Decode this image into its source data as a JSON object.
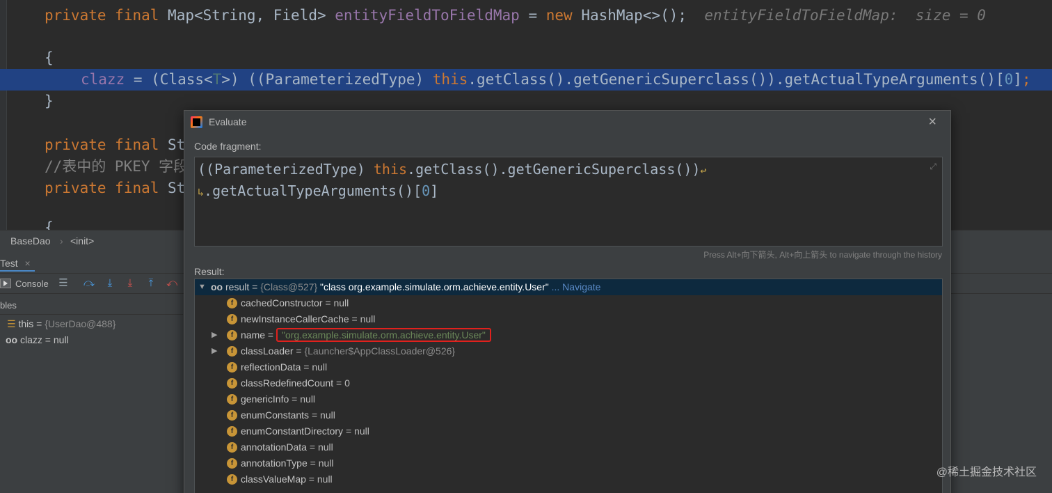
{
  "editor": {
    "line1": {
      "kw1": "private",
      "kw2": "final",
      "type": "Map<String, Field>",
      "field": "entityFieldToFieldMap",
      "eq": " = ",
      "kw3": "new",
      "ctor": "HashMap<>();",
      "hint": "entityFieldToFieldMap:  size = 0"
    },
    "line2": "{",
    "line3": {
      "field": "clazz",
      "eq": " = ",
      "cast_open": "(Class<",
      "tp": "T",
      "cast_close": ">)",
      "mid": " ((ParameterizedType) ",
      "kw": "this",
      "rest": ".getClass().getGenericSuperclass()).getActualTypeArguments()[",
      "num": "0",
      "end": "]",
      "semi": ";"
    },
    "line4": "}",
    "line5": {
      "kw1": "private",
      "kw2": "final",
      "rest": "St"
    },
    "line6": "//表中的 PKEY 字段",
    "line7": {
      "kw1": "private",
      "kw2": "final",
      "rest": "St"
    },
    "line8": "{"
  },
  "breadcrumb": {
    "class_name": "BaseDao",
    "separator": "›",
    "method": "<init>"
  },
  "debug": {
    "tab_label": "Test",
    "tab_close": "×",
    "console_label": "Console",
    "variables_header": "bles",
    "variables": [
      {
        "name": "this",
        "value": "{UserDao@488}",
        "icon": "list-icon"
      },
      {
        "name": "clazz",
        "value": "null",
        "icon": "watch-icon"
      }
    ]
  },
  "dialog": {
    "title": "Evaluate",
    "close": "×",
    "code_label": "Code fragment:",
    "code_line1": {
      "paren": "((ParameterizedType) ",
      "kw": "this",
      "rest": ".getClass().getGenericSuperclass())"
    },
    "code_line2": {
      "rest": ".getActualTypeArguments()[",
      "num": "0",
      "end": "]"
    },
    "history_hint": "Press Alt+向下箭头, Alt+向上箭头 to navigate through the history",
    "result_label": "Result:",
    "result": {
      "name": "result",
      "eq": " = ",
      "ref": "{Class@527}",
      "value": " \"class org.example.simulate.orm.achieve.entity.User\"",
      "nav": " ... Navigate"
    },
    "fields": [
      {
        "name": "cachedConstructor",
        "value": "null",
        "kind": "null",
        "expandable": false
      },
      {
        "name": "newInstanceCallerCache",
        "value": "null",
        "kind": "null",
        "expandable": false
      },
      {
        "name": "name",
        "value": "\"org.example.simulate.orm.achieve.entity.User\"",
        "kind": "str",
        "expandable": true,
        "boxed": true
      },
      {
        "name": "classLoader",
        "value": "{Launcher$AppClassLoader@526}",
        "kind": "ref",
        "expandable": true
      },
      {
        "name": "reflectionData",
        "value": "null",
        "kind": "null",
        "expandable": false
      },
      {
        "name": "classRedefinedCount",
        "value": "0",
        "kind": "null",
        "expandable": false
      },
      {
        "name": "genericInfo",
        "value": "null",
        "kind": "null",
        "expandable": false
      },
      {
        "name": "enumConstants",
        "value": "null",
        "kind": "null",
        "expandable": false
      },
      {
        "name": "enumConstantDirectory",
        "value": "null",
        "kind": "null",
        "expandable": false
      },
      {
        "name": "annotationData",
        "value": "null",
        "kind": "null",
        "expandable": false
      },
      {
        "name": "annotationType",
        "value": "null",
        "kind": "null",
        "expandable": false
      },
      {
        "name": "classValueMap",
        "value": "null",
        "kind": "null",
        "expandable": false
      }
    ]
  },
  "watermark": "@稀土掘金技术社区",
  "colors": {
    "selection": "#214283",
    "keyword": "#cc7832",
    "field": "#9876aa",
    "string": "#6a8759",
    "highlight_box": "#e0211d"
  }
}
